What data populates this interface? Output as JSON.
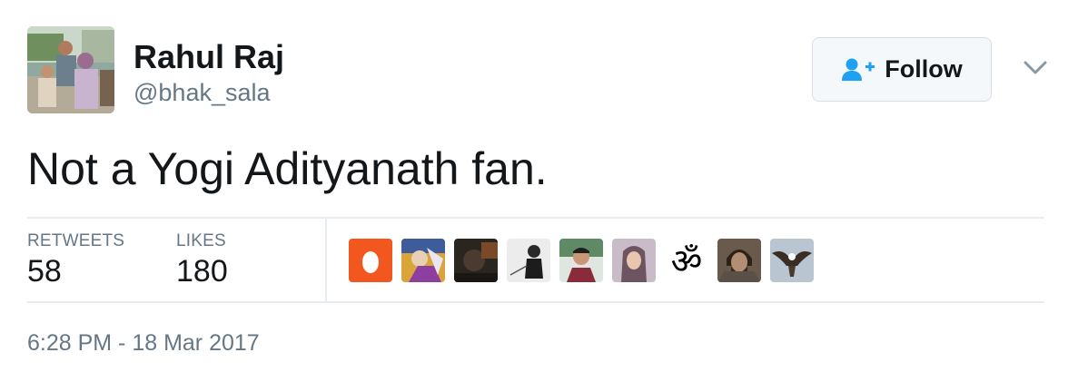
{
  "author": {
    "display_name": "Rahul Raj",
    "handle": "@bhak_sala",
    "avatar": "user-avatar-photo"
  },
  "follow_button": {
    "label": "Follow",
    "icon": "add-person-icon",
    "accent_color": "#1da1f2"
  },
  "menu_icon": "chevron-down-icon",
  "tweet": {
    "text": "Not a Yogi Adityanath fan."
  },
  "stats": {
    "retweets_label": "RETWEETS",
    "retweets_value": "58",
    "likes_label": "LIKES",
    "likes_value": "180"
  },
  "likers": [
    {
      "name": "liker-egg-avatar",
      "color": "#f2571f"
    },
    {
      "name": "liker-avatar-2",
      "color": "#d9a43a"
    },
    {
      "name": "liker-avatar-3",
      "color": "#2b2520"
    },
    {
      "name": "liker-avatar-4",
      "color": "#e5e5e5"
    },
    {
      "name": "liker-avatar-5",
      "color": "#4a6e54"
    },
    {
      "name": "liker-avatar-6",
      "color": "#b8a8b4"
    },
    {
      "name": "liker-om-avatar",
      "color": "#ffffff"
    },
    {
      "name": "liker-avatar-8",
      "color": "#6a5a4c"
    },
    {
      "name": "liker-eagle-avatar",
      "color": "#b9c6d2"
    }
  ],
  "timestamp": "6:28 PM - 18 Mar 2017"
}
